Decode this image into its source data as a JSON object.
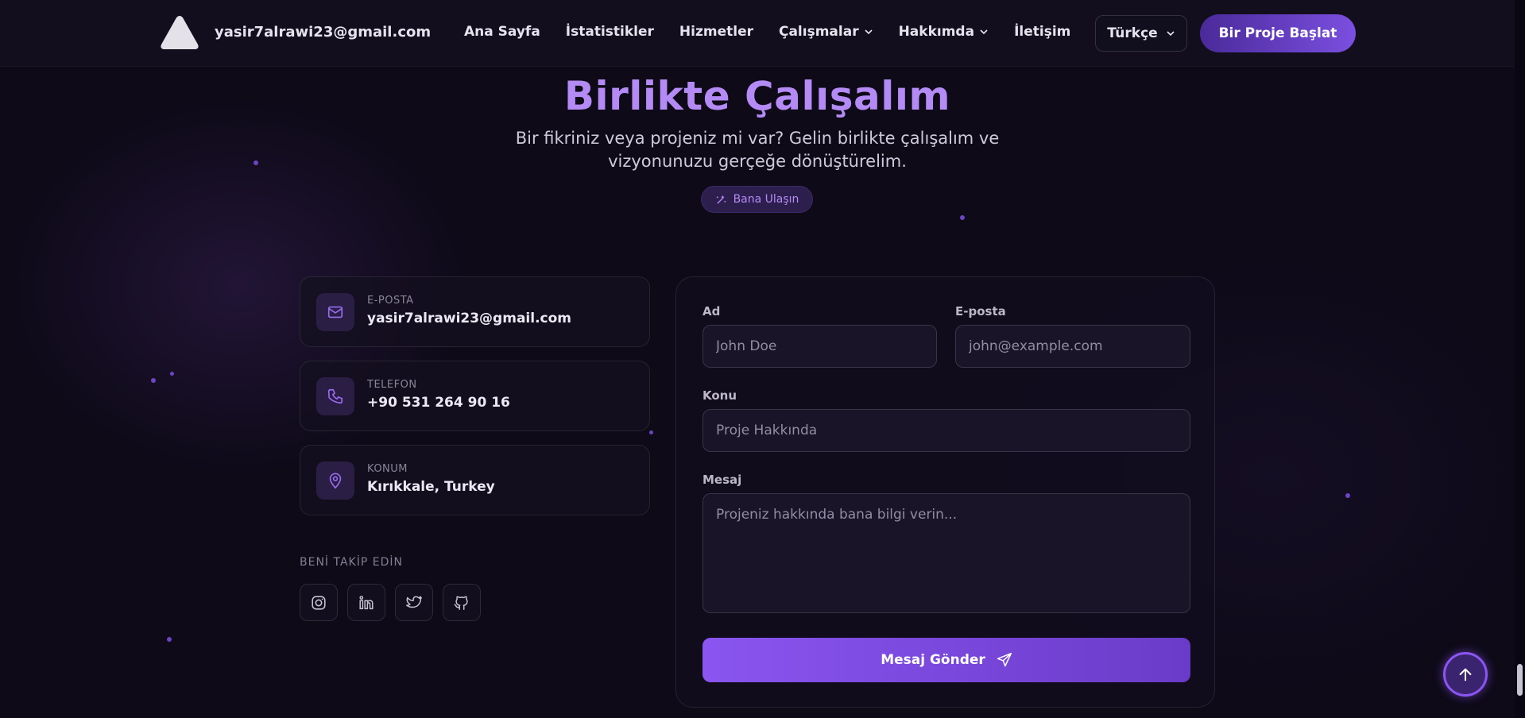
{
  "nav": {
    "brand_email": "yasir7alrawi23@gmail.com",
    "links": [
      {
        "label": "Ana Sayfa"
      },
      {
        "label": "İstatistikler"
      },
      {
        "label": "Hizmetler"
      },
      {
        "label": "Çalışmalar"
      },
      {
        "label": "Hakkımda"
      },
      {
        "label": "İletişim"
      }
    ],
    "language": "Türkçe",
    "cta": "Bir Proje Başlat"
  },
  "hero": {
    "title": "Birlikte Çalışalım",
    "subtitle": "Bir fikriniz veya projeniz mi var? Gelin birlikte çalışalım ve vizyonunuzu gerçeğe dönüştürelim.",
    "badge": "Bana Ulaşın"
  },
  "contact": {
    "cards": [
      {
        "label": "E-POSTA",
        "value": "yasir7alrawi23@gmail.com",
        "icon": "mail-icon"
      },
      {
        "label": "TELEFON",
        "value": "+90 531 264 90 16",
        "icon": "phone-icon"
      },
      {
        "label": "KONUM",
        "value": "Kırıkkale, Turkey",
        "icon": "map-pin-icon"
      }
    ],
    "follow_title": "BENİ TAKİP EDİN",
    "socials": [
      "instagram-icon",
      "linkedin-icon",
      "twitter-icon",
      "github-icon"
    ]
  },
  "form": {
    "name_label": "Ad",
    "name_placeholder": "John Doe",
    "email_label": "E-posta",
    "email_placeholder": "john@example.com",
    "subject_label": "Konu",
    "subject_placeholder": "Proje Hakkında",
    "message_label": "Mesaj",
    "message_placeholder": "Projeniz hakkında bana bilgi verin...",
    "submit": "Mesaj Gönder"
  },
  "colors": {
    "background": "#0e0a18",
    "accent": "#8a55f0",
    "title": "#b48af5"
  }
}
